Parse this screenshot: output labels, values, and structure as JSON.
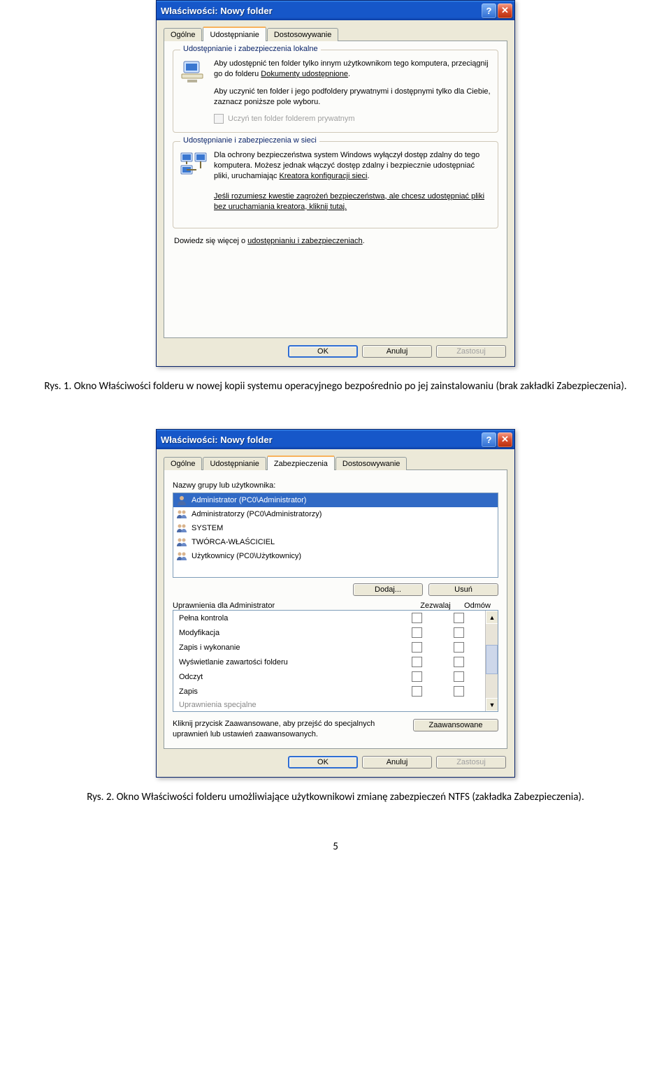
{
  "caption1": "Rys. 1. Okno Właściwości folderu w nowej kopii systemu operacyjnego bezpośrednio po jej zainstalowaniu (brak zakładki Zabezpieczenia).",
  "caption2": "Rys. 2. Okno Właściwości folderu  umożliwiające użytkownikowi zmianę zabezpieczeń NTFS (zakładka Zabezpieczenia).",
  "page_number": "5",
  "win1": {
    "title": "Właściwości: Nowy folder",
    "tabs": {
      "t1": "Ogólne",
      "t2": "Udostępnianie",
      "t3": "Dostosowywanie"
    },
    "group1": {
      "legend": "Udostępnianie i zabezpieczenia lokalne",
      "p1a": "Aby udostępnić ten folder tylko innym użytkownikom tego komputera, przeciągnij go do folderu ",
      "p1b": "Dokumenty udostępnione",
      "p1c": ".",
      "p2": "Aby uczynić ten folder i jego podfoldery prywatnymi i dostępnymi tylko dla Ciebie, zaznacz poniższe pole wyboru.",
      "chk": "Uczyń ten folder folderem prywatnym"
    },
    "group2": {
      "legend": "Udostępnianie i zabezpieczenia w sieci",
      "p1a": "Dla ochrony bezpieczeństwa system Windows wyłączył dostęp zdalny do tego komputera. Możesz jednak włączyć dostęp zdalny i bezpiecznie udostępniać pliki, uruchamiając ",
      "p1b": "Kreatora konfiguracji sieci",
      "p1c": ".",
      "p2": "Jeśli rozumiesz kwestie zagrożeń bezpieczeństwa, ale chcesz udostępniać pliki bez uruchamiania kreatora, kliknij tutaj."
    },
    "more_a": "Dowiedz się więcej o ",
    "more_b": "udostępnianiu i zabezpieczeniach",
    "more_c": ".",
    "ok": "OK",
    "cancel": "Anuluj",
    "apply": "Zastosuj"
  },
  "win2": {
    "title": "Właściwości: Nowy folder",
    "tabs": {
      "t1": "Ogólne",
      "t2": "Udostępnianie",
      "t3": "Zabezpieczenia",
      "t4": "Dostosowywanie"
    },
    "names_label": "Nazwy grupy lub użytkownika:",
    "users": [
      "Administrator (PC0\\Administrator)",
      "Administratorzy (PC0\\Administratorzy)",
      "SYSTEM",
      "TWÓRCA-WŁAŚCICIEL",
      "Użytkownicy (PC0\\Użytkownicy)"
    ],
    "add": "Dodaj...",
    "remove": "Usuń",
    "perm_for": "Uprawnienia dla Administrator",
    "allow": "Zezwalaj",
    "deny": "Odmów",
    "perms": [
      "Pełna kontrola",
      "Modyfikacja",
      "Zapis i wykonanie",
      "Wyświetlanie zawartości folderu",
      "Odczyt",
      "Zapis",
      "Uprawnienia specjalne"
    ],
    "advtxt": "Kliknij przycisk Zaawansowane, aby przejść do specjalnych uprawnień lub ustawień zaawansowanych.",
    "adv": "Zaawansowane",
    "ok": "OK",
    "cancel": "Anuluj",
    "apply": "Zastosuj"
  }
}
